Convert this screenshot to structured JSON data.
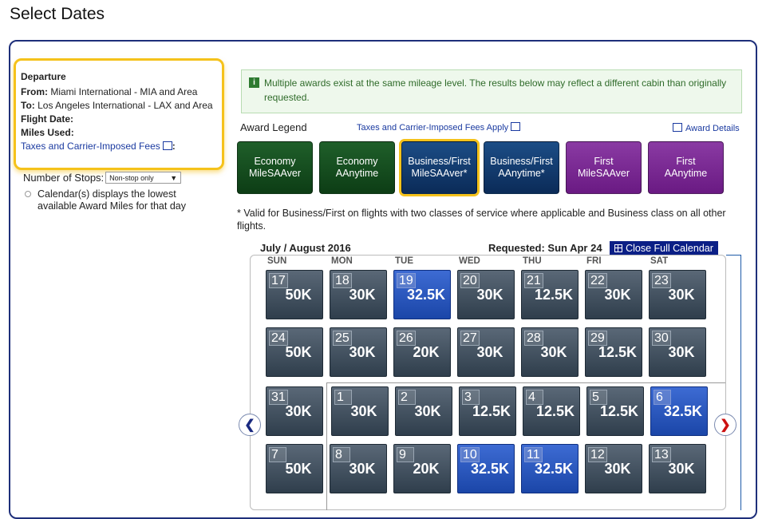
{
  "page_title": "Select Dates",
  "departure": {
    "heading": "Departure",
    "from_label": "From:",
    "from_value": "Miami International - MIA and Area",
    "to_label": "To:",
    "to_value": "Los Angeles International - LAX and Area",
    "flight_date_label": "Flight Date:",
    "miles_used_label": "Miles Used:",
    "fees_link": "Taxes and Carrier-Imposed Fees",
    "fees_colon": ":"
  },
  "stops": {
    "label": "Number of Stops:",
    "selected": "Non-stop only"
  },
  "calendar_note": "Calendar(s) displays the lowest available Award Miles for that day",
  "info_banner": "Multiple awards exist at the same mileage level. The results below may reflect a different cabin than originally requested.",
  "legend": {
    "title": "Award Legend",
    "fees_link": "Taxes and Carrier-Imposed Fees Apply",
    "details_link": "Award Details",
    "items": [
      {
        "line1": "Economy",
        "line2": "MileSAAver"
      },
      {
        "line1": "Economy",
        "line2": "AAnytime"
      },
      {
        "line1": "Business/First",
        "line2": "MileSAAver*"
      },
      {
        "line1": "Business/First",
        "line2": "AAnytime*"
      },
      {
        "line1": "First",
        "line2": "MileSAAver"
      },
      {
        "line1": "First",
        "line2": "AAnytime"
      }
    ]
  },
  "footnote": "* Valid for Business/First on flights with two classes of service where applicable and Business class on all other flights.",
  "calendar": {
    "month_label": "July / August 2016",
    "requested": "Requested: Sun Apr 24",
    "close_label": "Close Full Calendar",
    "days_of_week": [
      "SUN",
      "MON",
      "TUE",
      "WED",
      "THU",
      "FRI",
      "SAT"
    ],
    "weeks": [
      [
        {
          "d": "17",
          "v": "50K"
        },
        {
          "d": "18",
          "v": "30K"
        },
        {
          "d": "19",
          "v": "32.5K",
          "hl": true
        },
        {
          "d": "20",
          "v": "30K"
        },
        {
          "d": "21",
          "v": "12.5K"
        },
        {
          "d": "22",
          "v": "30K"
        },
        {
          "d": "23",
          "v": "30K"
        }
      ],
      [
        {
          "d": "24",
          "v": "50K"
        },
        {
          "d": "25",
          "v": "30K"
        },
        {
          "d": "26",
          "v": "20K"
        },
        {
          "d": "27",
          "v": "30K"
        },
        {
          "d": "28",
          "v": "30K"
        },
        {
          "d": "29",
          "v": "12.5K"
        },
        {
          "d": "30",
          "v": "30K"
        }
      ],
      [
        {
          "d": "31",
          "v": "30K"
        },
        {
          "d": "1",
          "v": "30K"
        },
        {
          "d": "2",
          "v": "30K"
        },
        {
          "d": "3",
          "v": "12.5K"
        },
        {
          "d": "4",
          "v": "12.5K"
        },
        {
          "d": "5",
          "v": "12.5K"
        },
        {
          "d": "6",
          "v": "32.5K",
          "hl": true
        }
      ],
      [
        {
          "d": "7",
          "v": "50K"
        },
        {
          "d": "8",
          "v": "30K"
        },
        {
          "d": "9",
          "v": "20K"
        },
        {
          "d": "10",
          "v": "32.5K",
          "hl": true
        },
        {
          "d": "11",
          "v": "32.5K",
          "hl": true
        },
        {
          "d": "12",
          "v": "30K"
        },
        {
          "d": "13",
          "v": "30K"
        }
      ]
    ],
    "prev_icon": "chevron-left-icon",
    "next_icon": "chevron-right-icon"
  },
  "colors": {
    "accent_yellow": "#f5c21b",
    "navy": "#0b1f86",
    "prev_arrow": "#1a2a80",
    "next_arrow": "#cc1111"
  }
}
